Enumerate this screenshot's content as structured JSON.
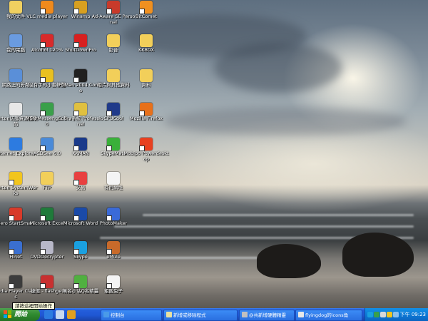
{
  "desktop_icons": [
    {
      "label": "我的文件",
      "icon": "my-documents-icon",
      "color": "#f0d060",
      "sc": false
    },
    {
      "label": "我的電腦",
      "icon": "my-computer-icon",
      "color": "#6a9be0",
      "sc": false
    },
    {
      "label": "網路上的芳鄰",
      "icon": "network-icon",
      "color": "#5a8fd8",
      "sc": false
    },
    {
      "label": "Norton防護資源回收筒",
      "icon": "recycle-bin-icon",
      "color": "#e8e8e8",
      "sc": false
    },
    {
      "label": "Internet Explorer",
      "icon": "ie-icon",
      "color": "#2d7be0",
      "sc": false
    },
    {
      "label": "Norton SystemWorks",
      "icon": "norton-icon",
      "color": "#f2c51e",
      "sc": true
    },
    {
      "label": "Nero StartSmart",
      "icon": "nero-icon",
      "color": "#d83a2a",
      "sc": true
    },
    {
      "label": "Hinet",
      "icon": "hinet-icon",
      "color": "#3a6fd0",
      "sc": true
    },
    {
      "label": "Media Player Classic",
      "icon": "media-player-icon",
      "color": "#3c3c3c",
      "sc": true
    },
    {
      "label": "VLC media player",
      "icon": "vlc-icon",
      "color": "#f08a1c",
      "sc": true
    },
    {
      "label": "Alcohol 120%",
      "icon": "alcohol-icon",
      "color": "#d82a2a",
      "sc": true
    },
    {
      "label": "沒有字的小書軟體",
      "icon": "book-app-icon",
      "color": "#e8c020",
      "sc": true
    },
    {
      "label": "MSN Messenger 7.0",
      "icon": "msn-icon",
      "color": "#3aa04a",
      "sc": true
    },
    {
      "label": "ACDSee 6.0",
      "icon": "acdsee-icon",
      "color": "#4a8ad8",
      "sc": true
    },
    {
      "label": "FTP",
      "icon": "ftp-folder-icon",
      "color": "#f2cf5a",
      "sc": false
    },
    {
      "label": "Microsoft Excel",
      "icon": "excel-icon",
      "color": "#1f7a3a",
      "sc": true
    },
    {
      "label": "DVDDecrypter",
      "icon": "dvd-decrypter-icon",
      "color": "#b8b8c8",
      "sc": true
    },
    {
      "label": "捷徑 - flashget",
      "icon": "flashget-icon",
      "color": "#c83030",
      "sc": true
    },
    {
      "label": "Winamp",
      "icon": "winamp-icon",
      "color": "#d8a020",
      "sc": true
    },
    {
      "label": "ShutDownPro",
      "icon": "shutdown-icon",
      "color": "#d82020",
      "sc": true
    },
    {
      "label": "PCMan 2004 Combo",
      "icon": "pcman-icon",
      "color": "#202020",
      "sc": true
    },
    {
      "label": "Cobra系統 Professional",
      "icon": "cobra-icon",
      "color": "#e0c040",
      "sc": true
    },
    {
      "label": "KKMAN",
      "icon": "kkman-icon",
      "color": "#1a3a8a",
      "sc": true
    },
    {
      "label": "交易",
      "icon": "trade-icon",
      "color": "#e84040",
      "sc": true
    },
    {
      "label": "Microsoft Word",
      "icon": "word-icon",
      "color": "#1a4aa8",
      "sc": true
    },
    {
      "label": "Skype",
      "icon": "skype-icon",
      "color": "#1aa0e0",
      "sc": true
    },
    {
      "label": "無名小站Q名精靈",
      "icon": "wretch-icon",
      "color": "#50b040",
      "sc": true
    },
    {
      "label": "Ad-Aware SE Personal",
      "icon": "adaware-icon",
      "color": "#c83a2a",
      "sc": true
    },
    {
      "label": "影音",
      "icon": "video-folder-icon",
      "color": "#f2cf5a",
      "sc": false
    },
    {
      "label": "相片與其他資料",
      "icon": "photos-folder-icon",
      "color": "#f2cf5a",
      "sc": false
    },
    {
      "label": "CPUCool",
      "icon": "cpucool-icon",
      "color": "#203a8a",
      "sc": true
    },
    {
      "label": "SkypeMate",
      "icon": "skypemate-icon",
      "color": "#3ab03a",
      "sc": true
    },
    {
      "label": "有用網址",
      "icon": "bookmarks-icon",
      "color": "#f4f4f4",
      "sc": false
    },
    {
      "label": "PhotoMaker",
      "icon": "photomaker-icon",
      "color": "#3a6ad8",
      "sc": true
    },
    {
      "label": "eMule",
      "icon": "emule-icon",
      "color": "#c86a2a",
      "sc": true
    },
    {
      "label": "粗飯兔子",
      "icon": "rabbit-icon",
      "color": "#f4f4f4",
      "sc": true
    },
    {
      "label": "BitComet",
      "icon": "bitcomet-icon",
      "color": "#f09020",
      "sc": true
    },
    {
      "label": "KKBOX",
      "icon": "kkbox-icon",
      "color": "#f2cf5a",
      "sc": false
    },
    {
      "label": "資料",
      "icon": "data-folder-icon",
      "color": "#f2cf5a",
      "sc": false
    },
    {
      "label": "Mozilla Firefox",
      "icon": "firefox-icon",
      "color": "#e8701a",
      "sc": true
    },
    {
      "label": "Mobipo Powerdesktop",
      "icon": "mobipo-icon",
      "color": "#e84020",
      "sc": true
    }
  ],
  "tooltip": "請按這裡開始操作",
  "taskbar": {
    "start_label": "開始",
    "quick_launch": [
      {
        "icon": "ie-quicklaunch-icon",
        "color": "#2d7be0"
      },
      {
        "icon": "show-desktop-icon",
        "color": "#c8d8f0"
      },
      {
        "icon": "media-quicklaunch-icon",
        "color": "#e0a020"
      }
    ],
    "buttons": [
      {
        "label": "控制台",
        "icon": "control-panel-icon",
        "color": "#4a9ae8"
      },
      {
        "label": "新增或移除程式",
        "icon": "add-remove-icon",
        "color": "#e8e0a0"
      },
      {
        "label": "@共新增硬體精靈",
        "icon": "hardware-wizard-icon",
        "color": "#c0c0c0"
      },
      {
        "label": "flyingdog的icons角",
        "icon": "browser-window-icon",
        "color": "#e8e8e8"
      }
    ],
    "tray_icons": [
      {
        "icon": "tray-skype-icon",
        "color": "#1aa0e0"
      },
      {
        "icon": "tray-msn-icon",
        "color": "#3aa04a"
      },
      {
        "icon": "tray-volume-icon",
        "color": "#d8d8d8"
      },
      {
        "icon": "tray-norton-icon",
        "color": "#f2c51e"
      },
      {
        "icon": "tray-network-icon",
        "color": "#8ac0f0"
      }
    ],
    "clock": "下午 09:23"
  }
}
